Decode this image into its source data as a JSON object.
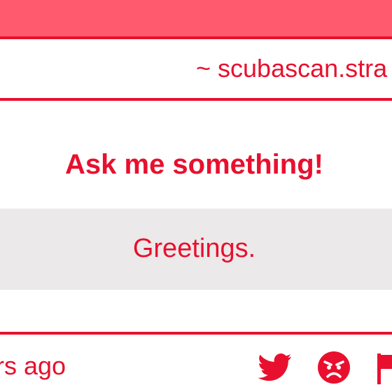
{
  "colors": {
    "brand": "#e8102e",
    "top_bar": "#ff5a6e",
    "answer_bg": "#ece9ea"
  },
  "header": {
    "url_text": "~ scubascan.stra"
  },
  "post": {
    "question": "Ask me something!",
    "answer": "Greetings."
  },
  "footer": {
    "time_text": "rs ago",
    "icons": [
      "twitter-icon",
      "angry-face-icon",
      "flag-icon"
    ]
  }
}
